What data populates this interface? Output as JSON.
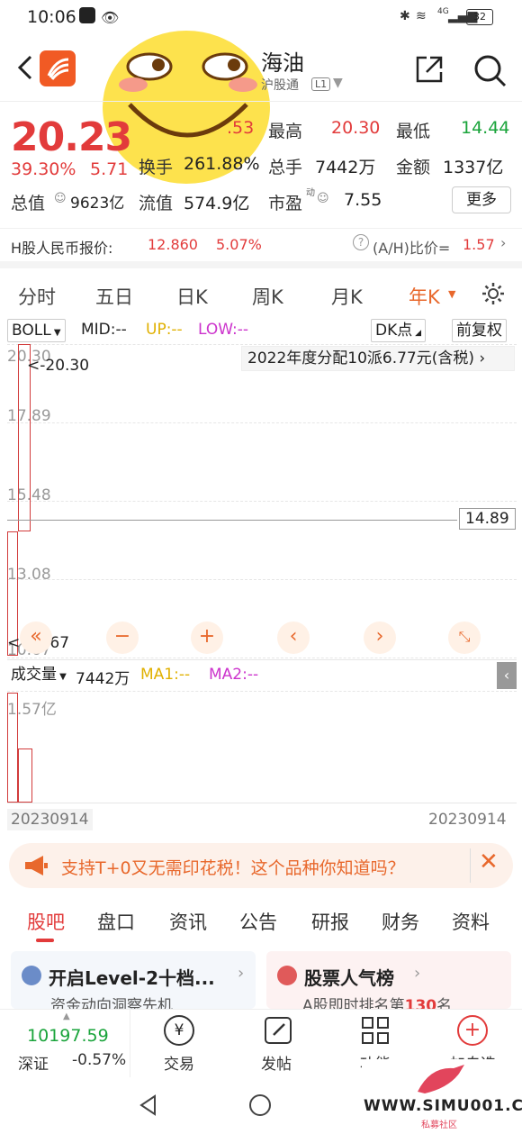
{
  "status": {
    "time": "10:06",
    "signal_label": "4G",
    "battery": "32"
  },
  "header": {
    "stock_name": "海油",
    "subtitle": "沪股通",
    "level": "L1"
  },
  "quote": {
    "price": "20.23",
    "change_pct": "39.30%",
    "change_amt": "5.71",
    "partial_label": ".53",
    "high_label": "最高",
    "high": "20.30",
    "low_label": "最低",
    "low": "14.44",
    "turnover_label": "换手",
    "turnover": "261.88%",
    "volume_label": "总手",
    "volume": "7442万",
    "amount_label": "金额",
    "amount": "1337亿",
    "mktcap_label": "总值",
    "mktcap": "9623亿",
    "float_label": "流值",
    "float": "574.9亿",
    "pe_label": "市盈",
    "pe_sup": "动",
    "pe": "7.55",
    "more": "更多",
    "h_label": "H股人民币报价:",
    "h_price": "12.860",
    "h_pct": "5.07%",
    "ah_label": "(A/H)比价=",
    "ah_value": "1.57"
  },
  "periods": [
    {
      "label": "分时"
    },
    {
      "label": "五日"
    },
    {
      "label": "日K"
    },
    {
      "label": "周K"
    },
    {
      "label": "月K"
    },
    {
      "label": "年K"
    }
  ],
  "indicator": {
    "name": "BOLL",
    "mid": "MID:--",
    "up": "UP:--",
    "low": "LOW:--",
    "dk": "DK点",
    "adj": "前复权"
  },
  "chart": {
    "dividend": "2022年度分配10派6.77元(含税)",
    "y_labels": [
      "20.30",
      "17.89",
      "15.48",
      "13.08",
      "10.67"
    ],
    "high_marker": "<-20.30",
    "low_marker": "<-10.67",
    "crosshair": "14.89"
  },
  "volume": {
    "label": "成交量",
    "value": "7442万",
    "ma1": "MA1:--",
    "ma2": "MA2:--",
    "y_label": "1.57亿"
  },
  "dates": {
    "start": "20230914",
    "end": "20230914"
  },
  "banner": {
    "text": "支持T+0又无需印花税！这个品种你知道吗？"
  },
  "tabs": [
    {
      "label": "股吧"
    },
    {
      "label": "盘口"
    },
    {
      "label": "资讯"
    },
    {
      "label": "公告"
    },
    {
      "label": "研报"
    },
    {
      "label": "财务"
    },
    {
      "label": "资料"
    }
  ],
  "cards": [
    {
      "title": "开启Level-2十档...",
      "sub": "资金动向洞察先机"
    },
    {
      "title": "股票人气榜",
      "sub_prefix": "A股即时排名第",
      "sub_num": "130",
      "sub_suffix": "名"
    }
  ],
  "bottom": {
    "index_value": "10197.59",
    "index_name": "深证",
    "index_pct": "-0.57%",
    "trade": "交易",
    "post": "发帖",
    "func": "功能",
    "watch": "加自选"
  },
  "watermark": {
    "text": "WWW.SIMU001.CN",
    "sub": "私募社区"
  },
  "colors": {
    "up": "#e23b3b",
    "down": "#1aa43b",
    "accent": "#e8682c",
    "boll_up": "#e0b000",
    "boll_low": "#cc33cc"
  }
}
